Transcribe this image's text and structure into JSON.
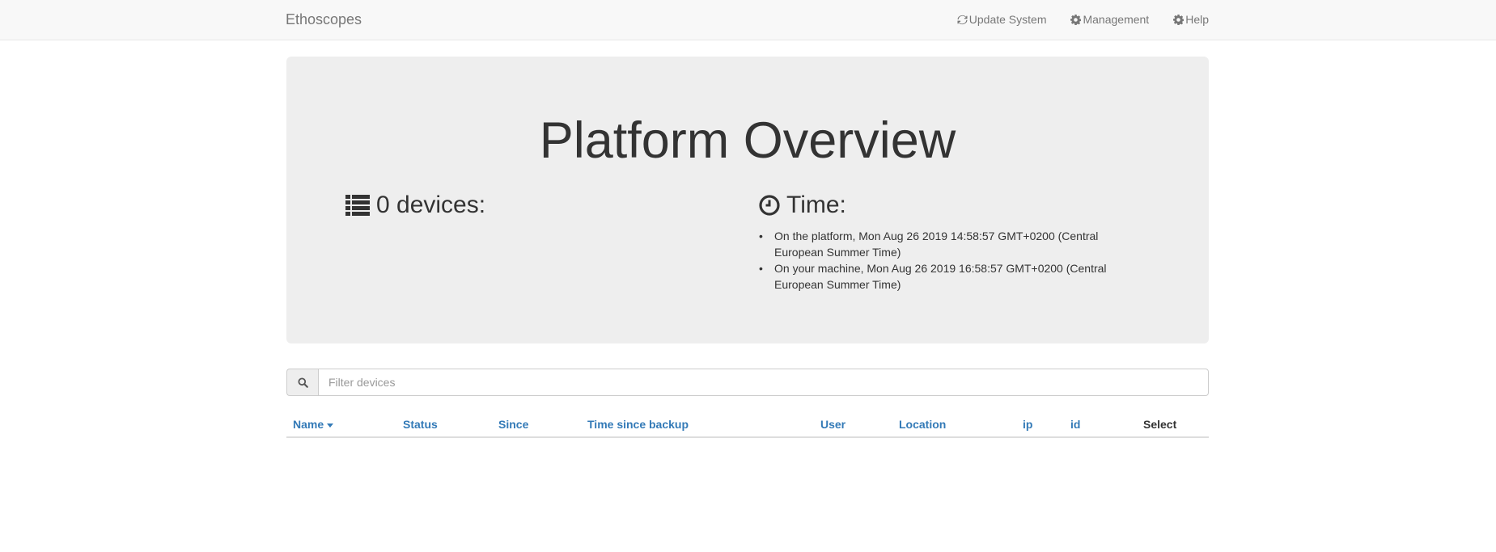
{
  "navbar": {
    "brand": "Ethoscopes",
    "links": [
      {
        "label": "Update System",
        "icon": "refresh-icon"
      },
      {
        "label": "Management",
        "icon": "gear-icon"
      },
      {
        "label": "Help",
        "icon": "gear-icon"
      }
    ]
  },
  "overview": {
    "title": "Platform Overview",
    "devices_heading": "0 devices:",
    "time_heading": "Time:",
    "time_items": [
      "On the platform, Mon Aug 26 2019 14:58:57 GMT+0200 (Central European Summer Time)",
      "On your machine, Mon Aug 26 2019 16:58:57 GMT+0200 (Central European Summer Time)"
    ]
  },
  "filter": {
    "placeholder": "Filter devices",
    "icon": "search-icon"
  },
  "table": {
    "columns": [
      "Name",
      "Status",
      "Since",
      "Time since backup",
      "User",
      "Location",
      "ip",
      "id",
      "Select"
    ],
    "sorted_column": "Name",
    "rows": []
  },
  "colors": {
    "link": "#337ab7",
    "navbar_bg": "#f8f8f8",
    "jumbotron_bg": "#eeeeee",
    "text": "#333333"
  }
}
